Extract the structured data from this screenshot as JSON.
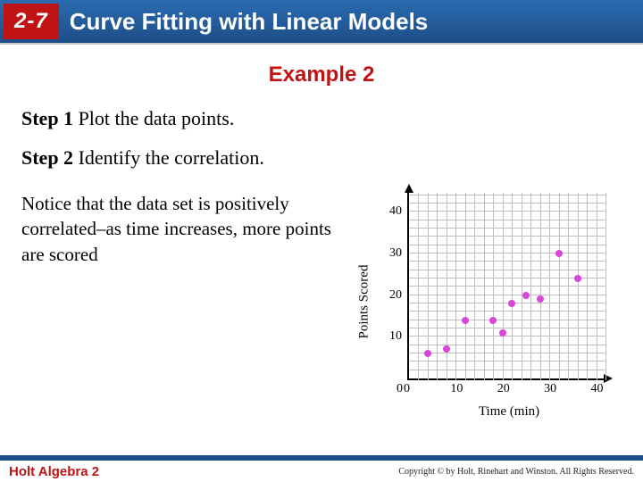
{
  "header": {
    "section": "2-7",
    "title": "Curve Fitting with Linear Models"
  },
  "example_label": "Example 2",
  "steps": [
    {
      "label": "Step 1",
      "text": " Plot the data points."
    },
    {
      "label": "Step 2",
      "text": " Identify the correlation."
    }
  ],
  "note": "Notice that the data set is positively correlated–as  time increases, more points are scored",
  "footer": {
    "book": "Holt Algebra 2",
    "copyright": "Copyright © by Holt, Rinehart and Winston. All Rights Reserved."
  },
  "chart_data": {
    "type": "scatter",
    "title": "",
    "xlabel": "Time (min)",
    "ylabel": "Points Scored",
    "xlim": [
      0,
      42
    ],
    "ylim": [
      0,
      45
    ],
    "xticks": [
      0,
      10,
      20,
      30,
      40
    ],
    "yticks": [
      0,
      10,
      20,
      30,
      40
    ],
    "grid": true,
    "points": [
      {
        "x": 4,
        "y": 6
      },
      {
        "x": 8,
        "y": 7
      },
      {
        "x": 12,
        "y": 14
      },
      {
        "x": 18,
        "y": 14
      },
      {
        "x": 20,
        "y": 11
      },
      {
        "x": 22,
        "y": 18
      },
      {
        "x": 25,
        "y": 20
      },
      {
        "x": 28,
        "y": 19
      },
      {
        "x": 32,
        "y": 30
      },
      {
        "x": 36,
        "y": 24
      }
    ]
  }
}
